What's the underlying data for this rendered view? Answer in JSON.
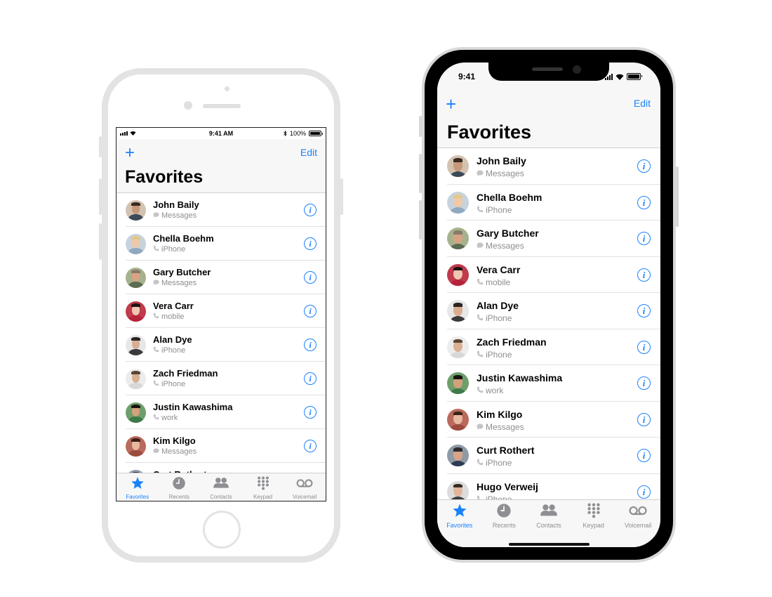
{
  "status_bar_8": {
    "time": "9:41 AM",
    "battery_text": "100%",
    "battery_level": 1.0
  },
  "status_bar_x": {
    "time": "9:41"
  },
  "nav": {
    "add_label": "+",
    "edit_label": "Edit",
    "title": "Favorites"
  },
  "contacts": [
    {
      "name": "John Baily",
      "type": "Messages",
      "icon": "message-bubble-icon",
      "skin": "#c7987a",
      "hair": "#3a2a1f",
      "shirt": "#3b4a58",
      "bg": "#d3c2b0"
    },
    {
      "name": "Chella Boehm",
      "type": "iPhone",
      "icon": "phone-icon",
      "skin": "#f0c9a7",
      "hair": "#e4c78a",
      "shirt": "#8fa9bf",
      "bg": "#c7d3dc"
    },
    {
      "name": "Gary Butcher",
      "type": "Messages",
      "icon": "message-bubble-icon",
      "skin": "#d8a384",
      "hair": "#8a7a6b",
      "shirt": "#5b6c52",
      "bg": "#a6b28d"
    },
    {
      "name": "Vera Carr",
      "type": "mobile",
      "icon": "phone-icon",
      "skin": "#f1c7b3",
      "hair": "#1c1414",
      "shirt": "#b6243c",
      "bg": "#c03b4c"
    },
    {
      "name": "Alan Dye",
      "type": "iPhone",
      "icon": "phone-icon",
      "skin": "#d9ad92",
      "hair": "#2a2520",
      "shirt": "#3a3a3d",
      "bg": "#e7e7e7"
    },
    {
      "name": "Zach Friedman",
      "type": "iPhone",
      "icon": "phone-icon",
      "skin": "#d9b092",
      "hair": "#5a4534",
      "shirt": "#d8d8d8",
      "bg": "#ececec"
    },
    {
      "name": "Justin Kawashima",
      "type": "work",
      "icon": "phone-icon",
      "skin": "#d3a17c",
      "hair": "#1a1410",
      "shirt": "#3f7a4a",
      "bg": "#6e9f6b"
    },
    {
      "name": "Kim Kilgo",
      "type": "Messages",
      "icon": "message-bubble-icon",
      "skin": "#e8b99e",
      "hair": "#3b2218",
      "shirt": "#9c4a3e",
      "bg": "#b96a5c"
    },
    {
      "name": "Curt Rothert",
      "type": "iPhone",
      "icon": "phone-icon",
      "skin": "#d7a488",
      "hair": "#2c2c2c",
      "shirt": "#2d3c55",
      "bg": "#8f9aa6"
    },
    {
      "name": "Hugo Verweij",
      "type": "iPhone",
      "icon": "phone-icon",
      "skin": "#e1b69b",
      "hair": "#3a2b20",
      "shirt": "#3c3c3c",
      "bg": "#dcdcdc"
    }
  ],
  "tabs": [
    {
      "label": "Favorites",
      "icon": "star-icon",
      "active": true
    },
    {
      "label": "Recents",
      "icon": "clock-icon",
      "active": false
    },
    {
      "label": "Contacts",
      "icon": "contacts-icon",
      "active": false
    },
    {
      "label": "Keypad",
      "icon": "keypad-icon",
      "active": false
    },
    {
      "label": "Voicemail",
      "icon": "voicemail-icon",
      "active": false
    }
  ],
  "colors": {
    "accent": "#1a82fb",
    "secondary_text": "#8e8e93",
    "inactive_tab": "#8e8e93"
  }
}
